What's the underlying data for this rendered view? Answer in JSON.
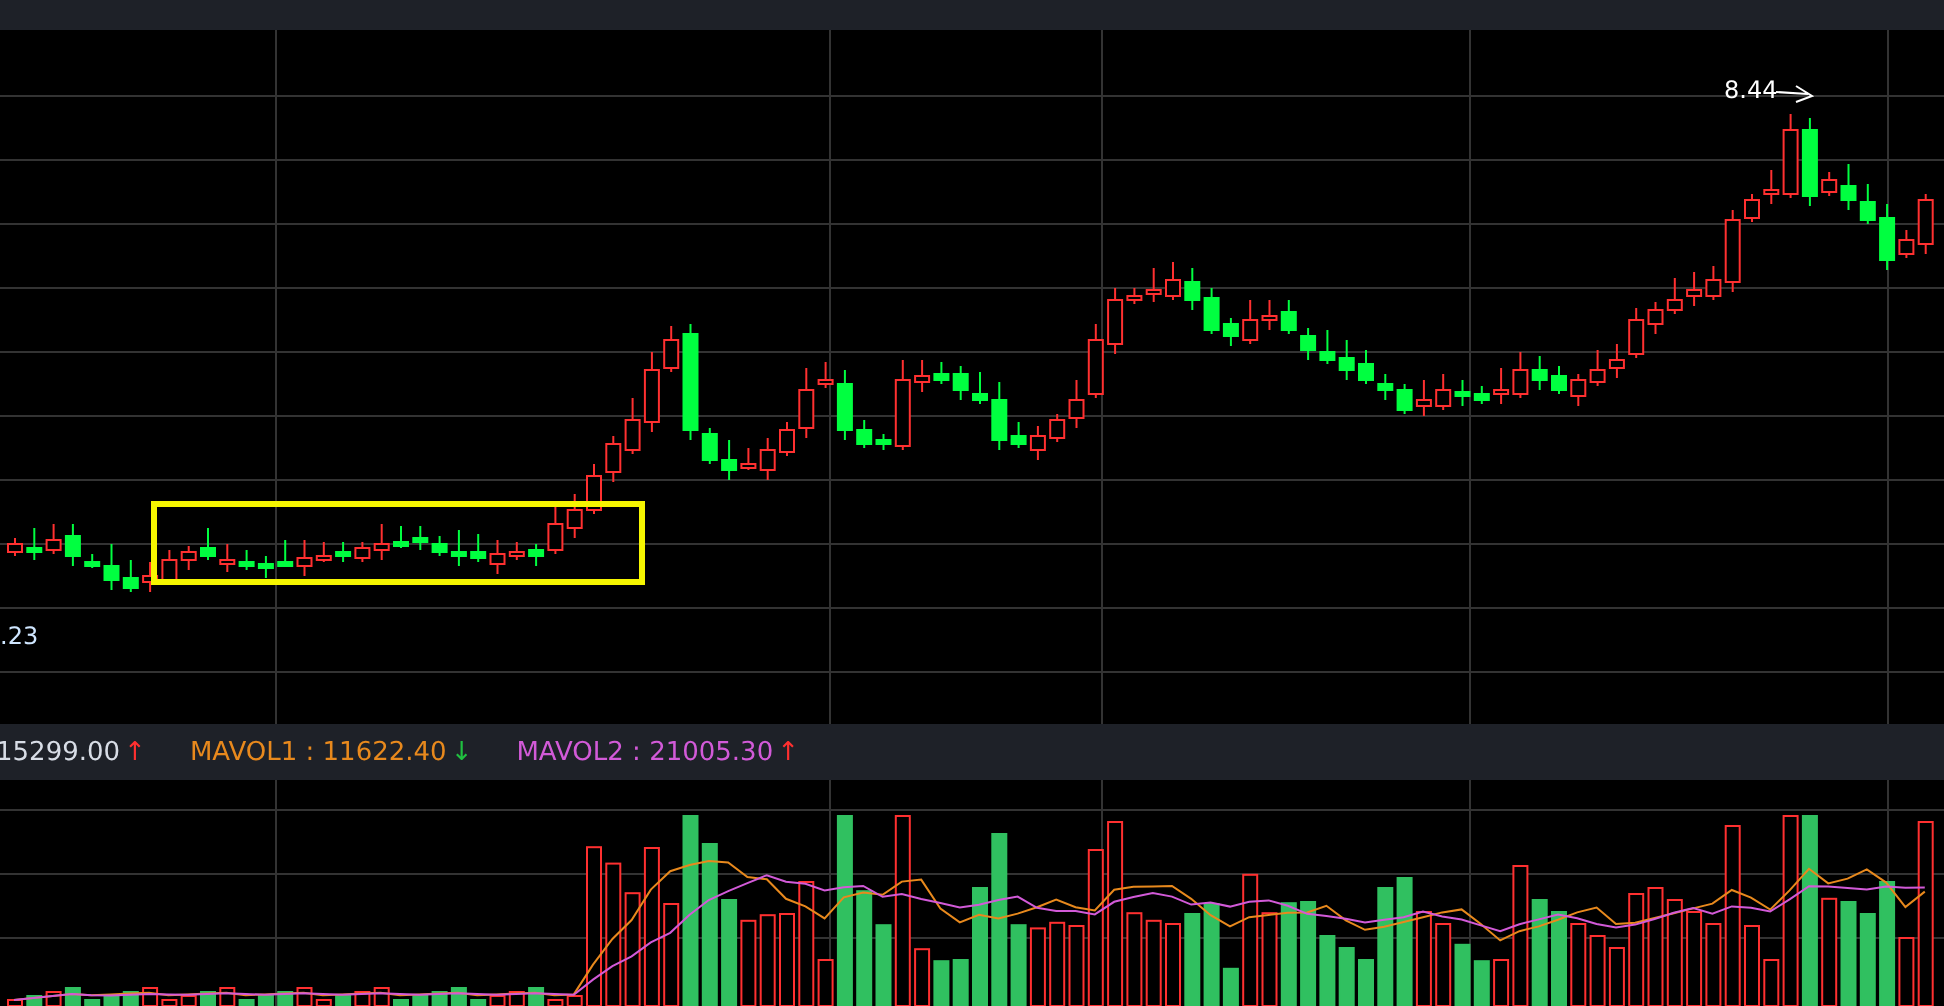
{
  "price_chart": {
    "high_label": "8.44",
    "low_label": ".23"
  },
  "volume_indicators": [
    {
      "value": "15299.00",
      "color": "#d8dde6",
      "arrow": {
        "text": "↑",
        "color": "#ff3030"
      }
    },
    {
      "label": "MAVOL1 : ",
      "value": "11622.40",
      "color": "#e8891d",
      "arrow": {
        "text": "↓",
        "color": "#20c040"
      }
    },
    {
      "label": "MAVOL2 : ",
      "value": "21005.30",
      "color": "#d25ad8",
      "arrow": {
        "text": "↑",
        "color": "#ff3030"
      }
    }
  ]
}
